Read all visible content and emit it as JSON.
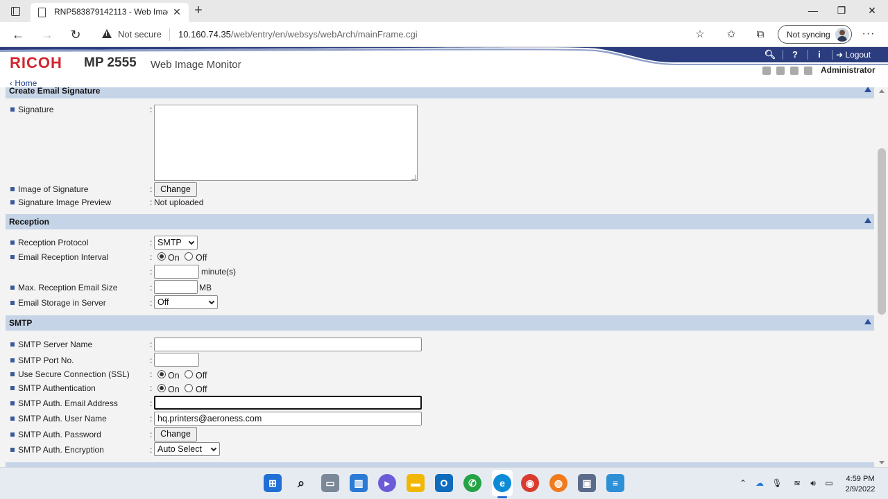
{
  "browser": {
    "tab_title": "RNP583879142113 - Web Image Monitor",
    "security_label": "Not secure",
    "url_host": "10.160.74.35",
    "url_path": "/web/entry/en/websys/webArch/mainFrame.cgi",
    "sync_label": "Not syncing"
  },
  "header": {
    "brand": "RICOH",
    "model": "MP 2555",
    "product": "Web Image Monitor",
    "logout_label": "Logout",
    "user": "Administrator",
    "home_link": "Home"
  },
  "sections": {
    "signature": {
      "title": "Create Email Signature",
      "signature_label": "Signature",
      "image_label": "Image of Signature",
      "image_button": "Change",
      "preview_label": "Signature Image Preview",
      "preview_value": "Not uploaded"
    },
    "reception": {
      "title": "Reception",
      "protocol_label": "Reception Protocol",
      "protocol_value": "SMTP",
      "interval_label": "Email Reception Interval",
      "interval_on": "On",
      "interval_off": "Off",
      "interval_unit": "minute(s)",
      "interval_value": "",
      "max_size_label": "Max. Reception Email Size",
      "max_size_value": "",
      "max_size_unit": "MB",
      "storage_label": "Email Storage in Server",
      "storage_value": "Off"
    },
    "smtp": {
      "title": "SMTP",
      "server_label": "SMTP Server Name",
      "server_value": "",
      "port_label": "SMTP Port No.",
      "port_value": "",
      "ssl_label": "Use Secure Connection (SSL)",
      "ssl_on": "On",
      "ssl_off": "Off",
      "auth_label": "SMTP Authentication",
      "auth_on": "On",
      "auth_off": "Off",
      "auth_email_label": "SMTP Auth. Email Address",
      "auth_email_value": "",
      "auth_user_label": "SMTP Auth. User Name",
      "auth_user_value": "hq.printers@aeroness.com",
      "auth_password_label": "SMTP Auth. Password",
      "auth_password_button": "Change",
      "auth_encryption_label": "SMTP Auth. Encryption",
      "auth_encryption_value": "Auto Select"
    }
  },
  "taskbar": {
    "time": "4:59 PM",
    "date": "2/9/2022"
  },
  "colors": {
    "brand_red": "#d22630",
    "header_navy": "#2b3d7e",
    "section_blue": "#c6d4e8"
  }
}
